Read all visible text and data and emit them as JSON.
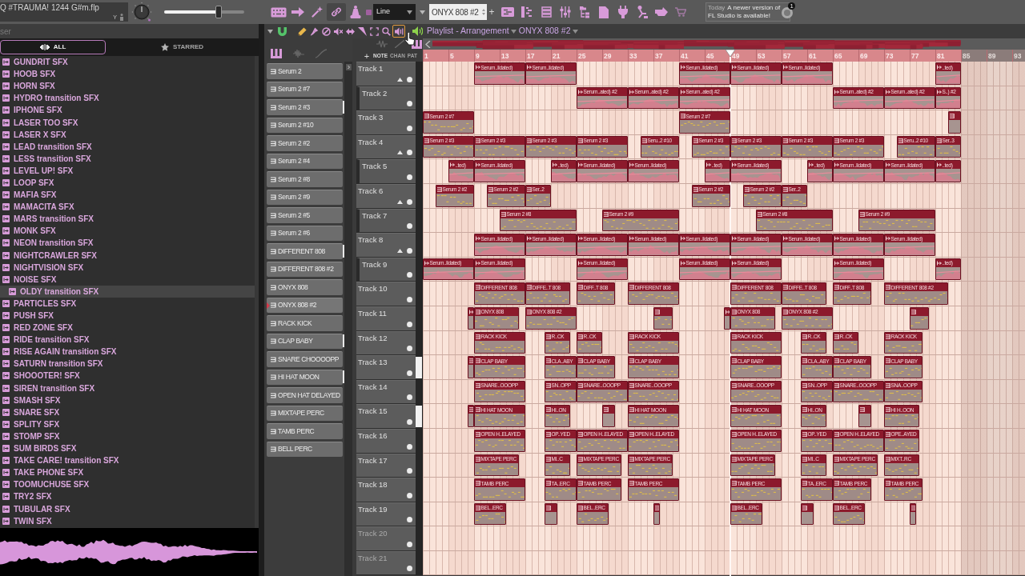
{
  "toolbar": {
    "project": "Q #TRAUMA! 1244 G#m.flp",
    "project_tag": "Y",
    "master_slider": {
      "level": 0.68
    },
    "buttons": [
      {
        "kind": "keyboard",
        "on": false
      },
      {
        "kind": "arrow",
        "on": false
      },
      {
        "kind": "wand",
        "on": false
      },
      {
        "kind": "link",
        "on": true
      },
      {
        "kind": "bell",
        "on": false
      },
      {
        "kind": "square",
        "on": false
      }
    ],
    "snap": "Line",
    "pattern": "ONYX 808 #2",
    "add": "+",
    "windows": [
      {
        "kind": "playlist"
      },
      {
        "kind": "piano-roll"
      },
      {
        "kind": "channel-rack"
      },
      {
        "kind": "mixer"
      },
      {
        "kind": "browser"
      },
      {
        "kind": "document"
      },
      {
        "kind": "plug"
      },
      {
        "kind": "lamp"
      },
      {
        "kind": "hand"
      },
      {
        "kind": "cart"
      }
    ],
    "news": {
      "day": "Today",
      "lines": [
        "A newer version of",
        "FL Studio is available!"
      ],
      "badge": "1"
    }
  },
  "browser": {
    "title": "ser",
    "tabs": [
      {
        "kind": "all",
        "label": "ALL",
        "selected": true
      },
      {
        "kind": "starred",
        "label": "STARRED",
        "selected": false
      }
    ],
    "items": [
      {
        "label": "GUNDRIT SFX",
        "selected": false
      },
      {
        "label": "HOOB SFX",
        "selected": false
      },
      {
        "label": "HORN SFX",
        "selected": false
      },
      {
        "label": "HYDRO transition SFX",
        "selected": false
      },
      {
        "label": "IPHONE SFX",
        "selected": false
      },
      {
        "label": "LASER TOO SFX",
        "selected": false
      },
      {
        "label": "LASER X SFX",
        "selected": false
      },
      {
        "label": "LEAD transition SFX",
        "selected": false
      },
      {
        "label": "LESS transition SFX",
        "selected": false
      },
      {
        "label": "LEVEL UP! SFX",
        "selected": false
      },
      {
        "label": "LOOP SFX",
        "selected": false
      },
      {
        "label": "MAFIA SFX",
        "selected": false
      },
      {
        "label": "MAMACITA SFX",
        "selected": false
      },
      {
        "label": "MARS transition SFX",
        "selected": false
      },
      {
        "label": "MONK SFX",
        "selected": false
      },
      {
        "label": "NEON transition SFX",
        "selected": false
      },
      {
        "label": "NIGHTCRAWLER SFX",
        "selected": false
      },
      {
        "label": "NIGHTVISION SFX",
        "selected": false
      },
      {
        "label": "NOISE SFX",
        "selected": false
      },
      {
        "label": "OLDY transition SFX",
        "selected": true
      },
      {
        "label": "PARTICLES SFX",
        "selected": false
      },
      {
        "label": "PUSH SFX",
        "selected": false
      },
      {
        "label": "RED ZONE SFX",
        "selected": false
      },
      {
        "label": "RIDE transition SFX",
        "selected": false
      },
      {
        "label": "RISE AGAIN transition SFX",
        "selected": false
      },
      {
        "label": "SATURN transition SFX",
        "selected": false
      },
      {
        "label": "SHOOOTER! SFX",
        "selected": false
      },
      {
        "label": "SIREN transition SFX",
        "selected": false
      },
      {
        "label": "SMASH SFX",
        "selected": false
      },
      {
        "label": "SNARE SFX",
        "selected": false
      },
      {
        "label": "SPLITY SFX",
        "selected": false
      },
      {
        "label": "STOMP SFX",
        "selected": false
      },
      {
        "label": "SUM BIRDS SFX",
        "selected": false
      },
      {
        "label": "TAKE CARE! transition SFX",
        "selected": false
      },
      {
        "label": "TAKE PHONE SFX",
        "selected": false
      },
      {
        "label": "TOOMUCHUSE SFX",
        "selected": false
      },
      {
        "label": "TRY2 SFX",
        "selected": false
      },
      {
        "label": "TUBULAR SFX",
        "selected": false
      },
      {
        "label": "TWIN SFX",
        "selected": false
      }
    ]
  },
  "playlist": {
    "title": "Playlist - Arrangement",
    "pattern": "ONYX 808 #2",
    "snap_on": true,
    "tools": [
      {
        "kind": "pencil",
        "selected": false
      },
      {
        "kind": "brush",
        "selected": false
      },
      {
        "kind": "delete",
        "selected": false
      },
      {
        "kind": "mute",
        "selected": false
      },
      {
        "kind": "slip",
        "selected": false
      },
      {
        "kind": "slice",
        "selected": false
      },
      {
        "kind": "select",
        "selected": false
      },
      {
        "kind": "zoom",
        "selected": false
      },
      {
        "kind": "playback",
        "selected": true
      }
    ],
    "picker": {
      "tabs": [
        {
          "kind": "pattern",
          "selected": true
        },
        {
          "kind": "audio",
          "selected": false
        },
        {
          "kind": "automation",
          "selected": false
        }
      ],
      "items": [
        {
          "label": "Serum 2",
          "selected": false,
          "marked": false
        },
        {
          "label": "Serum 2 #7",
          "selected": false,
          "marked": false
        },
        {
          "label": "Serum 2 #3",
          "selected": false,
          "marked": true
        },
        {
          "label": "Serum 2 #10",
          "selected": false,
          "marked": false
        },
        {
          "label": "Serum 2 #2",
          "selected": false,
          "marked": false
        },
        {
          "label": "Serum 2 #4",
          "selected": false,
          "marked": false
        },
        {
          "label": "Serum 2 #8",
          "selected": false,
          "marked": false
        },
        {
          "label": "Serum 2 #9",
          "selected": false,
          "marked": false
        },
        {
          "label": "Serum 2 #5",
          "selected": false,
          "marked": false
        },
        {
          "label": "Serum 2 #6",
          "selected": false,
          "marked": false
        },
        {
          "label": "DIFFERENT 808",
          "selected": false,
          "marked": true
        },
        {
          "label": "DIFFERENT 808 #2",
          "selected": false,
          "marked": false
        },
        {
          "label": "ONYX 808",
          "selected": false,
          "marked": false
        },
        {
          "label": "ONYX 808 #2",
          "selected": true,
          "marked": false
        },
        {
          "label": "RACK KICK",
          "selected": false,
          "marked": false
        },
        {
          "label": "CLAP BABY",
          "selected": false,
          "marked": true
        },
        {
          "label": "SNARE CHOOOOPP",
          "selected": false,
          "marked": false
        },
        {
          "label": "HI HAT MOON",
          "selected": false,
          "marked": true
        },
        {
          "label": "OPEN HAT DELAYED",
          "selected": false,
          "marked": false
        },
        {
          "label": "MIXTAPE PERC",
          "selected": false,
          "marked": false
        },
        {
          "label": "TAMB PERC",
          "selected": false,
          "marked": false
        },
        {
          "label": "BELL PERC",
          "selected": false,
          "marked": false
        }
      ]
    },
    "add_track": "+",
    "filters": [
      {
        "label": "NOTE",
        "selected": true
      },
      {
        "label": "CHAN",
        "selected": false
      },
      {
        "label": "PAT",
        "selected": false
      }
    ],
    "ruler": [
      "1",
      "5",
      "9",
      "13",
      "17",
      "21",
      "25",
      "29",
      "33",
      "37",
      "41",
      "45",
      "49",
      "53",
      "57",
      "61",
      "65",
      "69",
      "73",
      "77",
      "81",
      "85",
      "89",
      "93"
    ],
    "tracks": [
      {
        "name": "Track 1",
        "marked": false,
        "expanded": true,
        "clips": [
          {
            "kind": "audio",
            "label": "Serum..lidated)"
          },
          {
            "kind": "audio",
            "label": "Serum..lidated)"
          },
          {
            "kind": "audio",
            "label": "Serum..lidated)"
          },
          {
            "kind": "audio",
            "label": "Serum..lidated)"
          },
          {
            "kind": "audio",
            "label": "Serum..lidated)"
          },
          {
            "kind": "audio",
            "label": "..ted)"
          }
        ],
        "children": [
          {
            "name": "Track 2",
            "marked": false,
            "clips": [
              {
                "kind": "audio",
                "label": "Serum..ated) #2"
              },
              {
                "kind": "audio",
                "label": "Serum..ated) #2"
              },
              {
                "kind": "audio",
                "label": "Serum..ated) #2"
              },
              {
                "kind": "audio",
                "label": "Serum..ated) #2"
              },
              {
                "kind": "audio",
                "label": "Serum..ated) #2"
              },
              {
                "kind": "audio",
                "label": "S..) #2"
              }
            ]
          }
        ]
      },
      {
        "name": "Track 3",
        "marked": false,
        "clips": [
          {
            "kind": "pattern",
            "label": "Serum 2 #7"
          },
          {
            "kind": "pattern",
            "label": "Serum 2 #7"
          },
          {
            "kind": "pattern"
          }
        ]
      },
      {
        "name": "Track 4",
        "marked": false,
        "expanded": true,
        "clips": [
          {
            "kind": "pattern",
            "label": "Serum 2 #3"
          },
          {
            "kind": "pattern",
            "label": "Serum 2 #3"
          },
          {
            "kind": "pattern",
            "label": "Serum 2 #3"
          },
          {
            "kind": "pattern",
            "label": "Serum 2 #3"
          },
          {
            "kind": "pattern",
            "label": "Seru..2 #10"
          },
          {
            "kind": "pattern",
            "label": "Serum 2 #3"
          },
          {
            "kind": "pattern",
            "label": "Serum 2 #3"
          },
          {
            "kind": "pattern",
            "label": "Serum 2 #3"
          },
          {
            "kind": "pattern",
            "label": "Serum 2 #3"
          },
          {
            "kind": "pattern",
            "label": "Seru..2 #10"
          },
          {
            "kind": "pattern",
            "label": "Ser..3"
          }
        ],
        "children": [
          {
            "name": "Track 5",
            "marked": false,
            "clips": [
              {
                "kind": "audio",
                "label": "..ted)"
              },
              {
                "kind": "audio",
                "label": "Serum..lidated)"
              },
              {
                "kind": "audio",
                "label": "..ted)"
              },
              {
                "kind": "audio",
                "label": "Serum..lidated)"
              },
              {
                "kind": "audio",
                "label": "Serum..lidated)"
              },
              {
                "kind": "audio",
                "label": "..ted)"
              },
              {
                "kind": "audio",
                "label": "Serum..lidated)"
              },
              {
                "kind": "audio",
                "label": "..ted)"
              },
              {
                "kind": "audio",
                "label": "Serum..lidated)"
              },
              {
                "kind": "audio",
                "label": "Serum..lidated)"
              },
              {
                "kind": "audio",
                "label": "..ted)"
              }
            ]
          }
        ]
      },
      {
        "name": "Track 6",
        "marked": false,
        "expanded": true,
        "clips": [
          {
            "kind": "pattern",
            "label": "Serum 2 #2"
          },
          {
            "kind": "pattern",
            "label": "Serum 2 #2"
          },
          {
            "kind": "pattern",
            "label": "Ser..2"
          },
          {
            "kind": "pattern",
            "label": "Serum 2 #2"
          },
          {
            "kind": "pattern",
            "label": "Serum 2 #2"
          },
          {
            "kind": "pattern",
            "label": "Ser..2"
          }
        ],
        "children": [
          {
            "name": "Track 7",
            "marked": false,
            "clips": [
              {
                "kind": "pattern",
                "label": "Serum 2 #8"
              },
              {
                "kind": "pattern",
                "label": "Serum 2 #9"
              },
              {
                "kind": "pattern",
                "label": "Serum 2 #8"
              },
              {
                "kind": "pattern",
                "label": "Serum 2 #9"
              }
            ]
          }
        ]
      },
      {
        "name": "Track 8",
        "marked": false,
        "expanded": true,
        "clips": [
          {
            "kind": "audio",
            "label": "Serum..lidated)"
          },
          {
            "kind": "audio",
            "label": "Serum..lidated)"
          },
          {
            "kind": "audio",
            "label": "Serum..lidated)"
          },
          {
            "kind": "audio",
            "label": "Serum..lidated)"
          },
          {
            "kind": "audio",
            "label": "Serum..lidated)"
          },
          {
            "kind": "audio",
            "label": "Serum..lidated)"
          },
          {
            "kind": "audio",
            "label": "Serum..lidated)"
          },
          {
            "kind": "audio",
            "label": "Serum..lidated)"
          },
          {
            "kind": "audio",
            "label": "Serum..lidated)"
          }
        ],
        "children": [
          {
            "name": "Track 9",
            "marked": false,
            "clips": [
              {
                "kind": "audio",
                "label": "Serum..lidated)"
              },
              {
                "kind": "audio",
                "label": "Serum..lidated)"
              },
              {
                "kind": "audio",
                "label": "Serum..lidated)"
              },
              {
                "kind": "audio",
                "label": "Serum..lidated)"
              },
              {
                "kind": "audio",
                "label": "Serum..lidated)"
              },
              {
                "kind": "audio",
                "label": "Serum..lidated)"
              },
              {
                "kind": "audio",
                "label": "..ted)"
              }
            ]
          }
        ]
      },
      {
        "name": "Track 10",
        "marked": false,
        "clips": [
          {
            "kind": "pattern",
            "label": "DIFFERENT 808"
          },
          {
            "kind": "pattern",
            "label": "DIFFE..T 808"
          },
          {
            "kind": "pattern",
            "label": "DIFF..T 808"
          },
          {
            "kind": "pattern",
            "label": "DIFFERENT 808"
          },
          {
            "kind": "pattern",
            "label": "DIFFERENT 808"
          },
          {
            "kind": "pattern",
            "label": "DIFFE..T 808"
          },
          {
            "kind": "pattern",
            "label": "DIFF..T 808"
          },
          {
            "kind": "pattern",
            "label": "DIFFERENT 808 #2"
          }
        ]
      },
      {
        "name": "Track 11",
        "marked": false,
        "clips": [
          {
            "kind": "audio"
          },
          {
            "kind": "pattern",
            "label": "ONYX 808"
          },
          {
            "kind": "pattern",
            "label": "ONYX 808 #2"
          },
          {
            "kind": "pattern"
          },
          {
            "kind": "audio"
          },
          {
            "kind": "pattern",
            "label": "ONYX 808"
          },
          {
            "kind": "pattern",
            "label": "ONYX 808 #2"
          },
          {
            "kind": "pattern"
          }
        ]
      },
      {
        "name": "Track 12",
        "marked": false,
        "clips": [
          {
            "kind": "pattern",
            "label": "RACK KICK"
          },
          {
            "kind": "pattern",
            "label": "R..CK"
          },
          {
            "kind": "pattern",
            "label": "R..CK"
          },
          {
            "kind": "pattern",
            "label": "RACK KICK"
          },
          {
            "kind": "pattern",
            "label": "RACK KICK"
          },
          {
            "kind": "pattern",
            "label": "R..CK"
          },
          {
            "kind": "pattern",
            "label": "R..CK"
          },
          {
            "kind": "pattern",
            "label": "RACK KICK"
          }
        ]
      },
      {
        "name": "Track 13",
        "marked": true,
        "clips": [
          {
            "kind": "pattern"
          },
          {
            "kind": "pattern",
            "label": "CLAP BABY"
          },
          {
            "kind": "pattern",
            "label": "CLA..ABY"
          },
          {
            "kind": "pattern",
            "label": "CLAP BABY"
          },
          {
            "kind": "pattern",
            "label": "CLAP BABY"
          },
          {
            "kind": "pattern",
            "label": "CLAP BABY"
          },
          {
            "kind": "pattern",
            "label": "CLA..ABY"
          },
          {
            "kind": "pattern",
            "label": "CLAP BABY"
          },
          {
            "kind": "pattern",
            "label": "CLAP BABY"
          }
        ]
      },
      {
        "name": "Track 14",
        "marked": false,
        "clips": [
          {
            "kind": "pattern",
            "label": "SNARE..OOOPP"
          },
          {
            "kind": "pattern",
            "label": "SN..OPP"
          },
          {
            "kind": "pattern",
            "label": "SNARE..OOOPP"
          },
          {
            "kind": "pattern",
            "label": "SNARE..OOOPP"
          },
          {
            "kind": "pattern",
            "label": "SNARE..OOOPP"
          },
          {
            "kind": "pattern",
            "label": "SN..OPP"
          },
          {
            "kind": "pattern",
            "label": "SNARE..OOOPP"
          },
          {
            "kind": "pattern",
            "label": "SNA..OOPP"
          }
        ]
      },
      {
        "name": "Track 15",
        "marked": true,
        "clips": [
          {
            "kind": "pattern"
          },
          {
            "kind": "pattern",
            "label": "HI HAT MOON"
          },
          {
            "kind": "pattern",
            "label": "HI..ON"
          },
          {
            "kind": "pattern"
          },
          {
            "kind": "pattern",
            "label": "HI HAT MOON"
          },
          {
            "kind": "pattern",
            "label": "HI HAT MOON"
          },
          {
            "kind": "pattern",
            "label": "HI..ON"
          },
          {
            "kind": "pattern"
          },
          {
            "kind": "pattern",
            "label": "HI H..OON"
          }
        ]
      },
      {
        "name": "Track 16",
        "marked": false,
        "clips": [
          {
            "kind": "pattern",
            "label": "OPEN H..ELAYED"
          },
          {
            "kind": "pattern",
            "label": "OP..YED"
          },
          {
            "kind": "pattern",
            "label": "OPEN H..ELAYED"
          },
          {
            "kind": "pattern",
            "label": "OPEN H..ELAYED"
          },
          {
            "kind": "pattern",
            "label": "OPEN H..ELAYED"
          },
          {
            "kind": "pattern",
            "label": "OP..YED"
          },
          {
            "kind": "pattern",
            "label": "OPEN H..ELAYED"
          },
          {
            "kind": "pattern",
            "label": "OPE..AYED"
          }
        ]
      },
      {
        "name": "Track 17",
        "marked": false,
        "clips": [
          {
            "kind": "pattern",
            "label": "MIXTAPE PERC"
          },
          {
            "kind": "pattern",
            "label": "MI..C"
          },
          {
            "kind": "pattern",
            "label": "MIXTAPE PERC"
          },
          {
            "kind": "pattern",
            "label": "MIXTAPE PERC"
          },
          {
            "kind": "pattern",
            "label": "MIXTAPE PERC"
          },
          {
            "kind": "pattern",
            "label": "MI..C"
          },
          {
            "kind": "pattern",
            "label": "MIXTAPE PERC"
          },
          {
            "kind": "pattern",
            "label": "MIXT..RC"
          }
        ]
      },
      {
        "name": "Track 18",
        "marked": false,
        "clips": [
          {
            "kind": "pattern",
            "label": "TAMB PERC"
          },
          {
            "kind": "pattern",
            "label": "TA..ERC"
          },
          {
            "kind": "pattern",
            "label": "TAMB PERC"
          },
          {
            "kind": "pattern",
            "label": "TAMB PERC"
          },
          {
            "kind": "pattern",
            "label": "TAMB PERC"
          },
          {
            "kind": "pattern",
            "label": "TA..ERC"
          },
          {
            "kind": "pattern",
            "label": "TAMB PERC"
          },
          {
            "kind": "pattern",
            "label": "TAMB PERC"
          }
        ]
      },
      {
        "name": "Track 19",
        "marked": false,
        "clips": [
          {
            "kind": "pattern",
            "label": "BEL..ERC"
          },
          {
            "kind": "pattern"
          },
          {
            "kind": "pattern",
            "label": "BEL..ERC"
          },
          {
            "kind": "pattern"
          },
          {
            "kind": "pattern",
            "label": "BEL..ERC"
          },
          {
            "kind": "pattern"
          },
          {
            "kind": "pattern",
            "label": "BEL..ERC"
          },
          {
            "kind": "pattern"
          }
        ]
      },
      {
        "name": "Track 20",
        "marked": false
      },
      {
        "name": "Track 21",
        "marked": false
      }
    ]
  }
}
